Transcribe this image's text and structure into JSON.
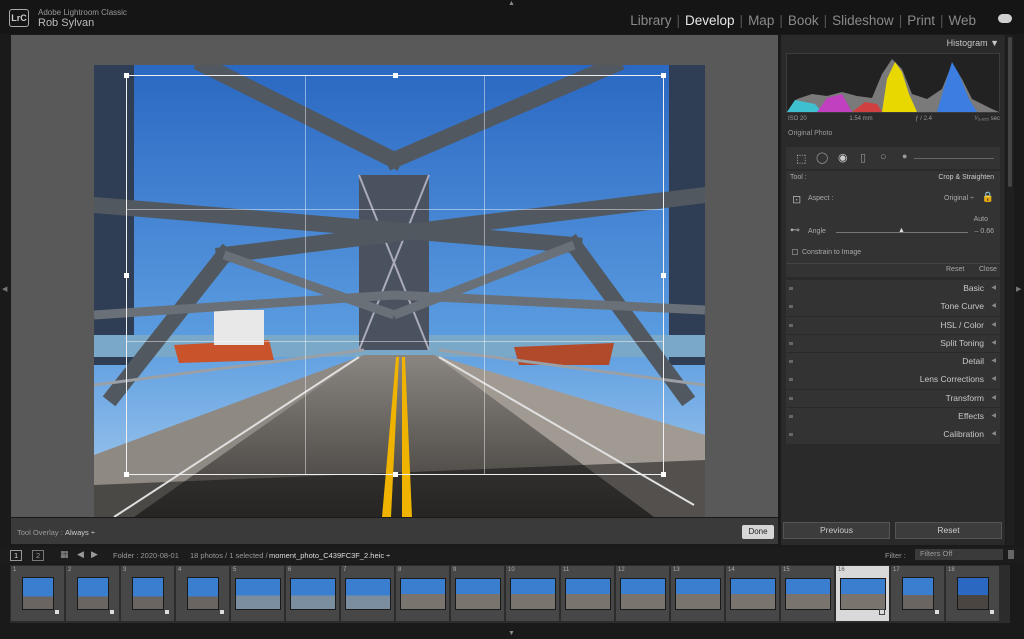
{
  "header": {
    "app_name": "Adobe Lightroom Classic",
    "logo_text": "LrC",
    "user": "Rob Sylvan",
    "modules": [
      "Library",
      "Develop",
      "Map",
      "Book",
      "Slideshow",
      "Print",
      "Web"
    ],
    "active_module": "Develop"
  },
  "toolbar": {
    "overlay_label": "Tool Overlay :",
    "overlay_value": "Always ÷",
    "done_label": "Done"
  },
  "histogram": {
    "title": "Histogram ▼",
    "iso": "ISO 20",
    "focal": "1.54 mm",
    "aperture": "ƒ / 2.4",
    "shutter": "¹⁄₃,₆₅₅ sec",
    "original_photo": "Original Photo"
  },
  "crop_panel": {
    "tool_label": "Tool :",
    "tool_name": "Crop & Straighten",
    "aspect_label": "Aspect :",
    "aspect_value": "Original ÷",
    "auto_label": "Auto",
    "angle_label": "Angle",
    "angle_value": "– 0.66",
    "constrain_label": "Constrain to Image",
    "reset_label": "Reset",
    "close_label": "Close"
  },
  "panels": [
    "Basic",
    "Tone Curve",
    "HSL / Color",
    "Split Toning",
    "Detail",
    "Lens Corrections",
    "Transform",
    "Effects",
    "Calibration"
  ],
  "bottom_buttons": {
    "previous": "Previous",
    "reset": "Reset"
  },
  "filmstrip_bar": {
    "page1": "1",
    "page2": "2",
    "folder": "Folder : 2020-08-01",
    "count": "18 photos / 1 selected /",
    "filename": "moment_photo_C439FC3F_2.heic ÷",
    "filter_label": "Filter :",
    "filter_value": "Filters Off"
  },
  "thumbnails": [
    "1",
    "2",
    "3",
    "4",
    "5",
    "6",
    "7",
    "8",
    "9",
    "10",
    "11",
    "12",
    "13",
    "14",
    "15",
    "16",
    "17",
    "18"
  ],
  "selected_thumbnail": "16",
  "colors": {
    "accent": "#e8e8e8",
    "sky": "#3a7fd0",
    "road": "#6b6763"
  }
}
